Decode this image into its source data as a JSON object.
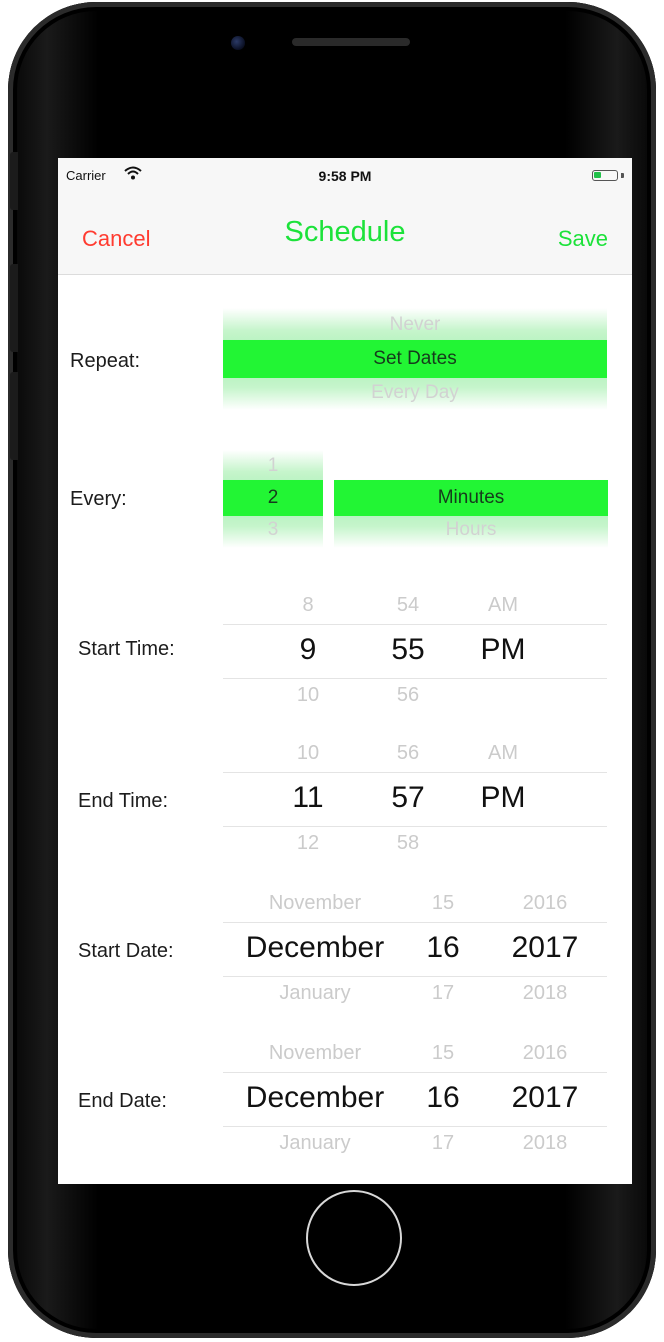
{
  "status_bar": {
    "carrier": "Carrier",
    "time": "9:58 PM",
    "battery_level": 0.35
  },
  "nav": {
    "cancel_label": "Cancel",
    "title": "Schedule",
    "save_label": "Save"
  },
  "repeat": {
    "label": "Repeat:",
    "options": [
      "Never",
      "Set Dates",
      "Every Day"
    ],
    "selected": "Set Dates"
  },
  "every": {
    "label": "Every:",
    "number_options": [
      "1",
      "2",
      "3"
    ],
    "number_selected": "2",
    "unit_options": [
      "Minutes",
      "Hours"
    ],
    "unit_selected": "Minutes"
  },
  "start_time": {
    "label": "Start Time:",
    "hour": {
      "above": "8",
      "selected": "9",
      "below": "10"
    },
    "minute": {
      "above": "54",
      "selected": "55",
      "below": "56"
    },
    "period": {
      "above": "AM",
      "selected": "PM"
    }
  },
  "end_time": {
    "label": "End Time:",
    "hour": {
      "above": "10",
      "selected": "11",
      "below": "12"
    },
    "minute": {
      "above": "56",
      "selected": "57",
      "below": "58"
    },
    "period": {
      "above": "AM",
      "selected": "PM"
    }
  },
  "start_date": {
    "label": "Start Date:",
    "month": {
      "above": "November",
      "selected": "December",
      "below": "January"
    },
    "day": {
      "above": "15",
      "selected": "16",
      "below": "17"
    },
    "year": {
      "above": "2016",
      "selected": "2017",
      "below": "2018"
    }
  },
  "end_date": {
    "label": "End Date:",
    "month": {
      "above": "November",
      "selected": "December",
      "below": "January"
    },
    "day": {
      "above": "15",
      "selected": "16",
      "below": "17"
    },
    "year": {
      "above": "2016",
      "selected": "2017",
      "below": "2018"
    }
  },
  "colors": {
    "accent_green": "#1ce23a",
    "selection_green": "#22f534",
    "cancel_red": "#ff3b30"
  }
}
